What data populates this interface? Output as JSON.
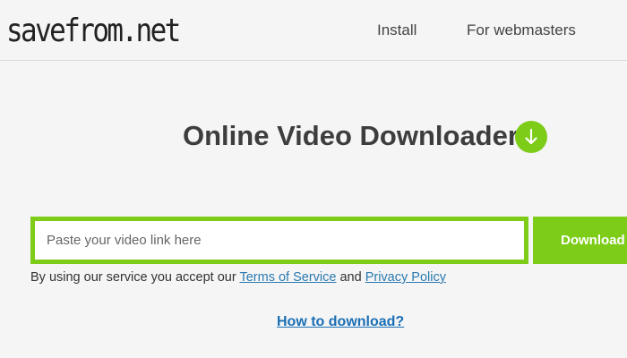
{
  "header": {
    "logo_text": "savefrom.net",
    "nav": {
      "install": "Install",
      "webmasters": "For webmasters"
    }
  },
  "hero": {
    "title": "Online Video Downloader",
    "icon": "arrow-down-circle-icon"
  },
  "search": {
    "placeholder": "Paste your video link here",
    "value": "",
    "button_label": "Download"
  },
  "terms": {
    "prefix": "By using our service you accept our ",
    "tos_link": "Terms of Service",
    "middle": " and ",
    "privacy_link": "Privacy Policy"
  },
  "help": {
    "how_to_link": "How to download?"
  },
  "colors": {
    "accent": "#7ccc18",
    "link": "#2a7ab0",
    "background": "#f5f5f5"
  }
}
